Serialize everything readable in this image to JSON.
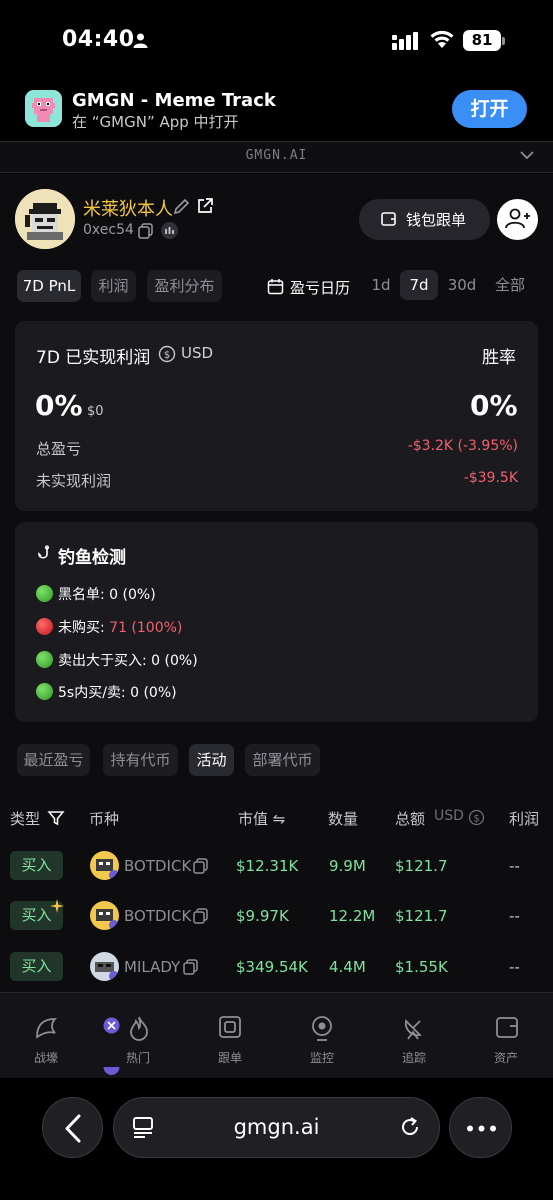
{
  "status_bar": {
    "time": "04:40",
    "battery": "81"
  },
  "banner": {
    "title": "GMGN - Meme Track",
    "subtitle": "在 “GMGN” App 中打开",
    "open_label": "打开"
  },
  "url_strip": {
    "text": "GMGN.AI"
  },
  "profile": {
    "nickname": "米莱狄本人",
    "address": "0xec54",
    "follow_label": "钱包跟单"
  },
  "period_tabs": {
    "items": [
      "7D PnL",
      "利润",
      "盈利分布"
    ],
    "calendar_label": "盈亏日历",
    "ranges": [
      "1d",
      "7d",
      "30d",
      "全部"
    ]
  },
  "pnl_card": {
    "title": "7D 已实现利润",
    "unit": "USD",
    "winrate_label": "胜率",
    "realized_pct": "0%",
    "realized_usd": "$0",
    "winrate_value": "0%",
    "total_label": "总盈亏",
    "total_value": "-$3.2K (-3.95%)",
    "unrealized_label": "未实现利润",
    "unrealized_value": "-$39.5K"
  },
  "phishing_card": {
    "title": "钓鱼检测",
    "checks": [
      {
        "label": "黑名单: ",
        "value": "0 (0%)",
        "status": "green"
      },
      {
        "label": "未购买: ",
        "value": "71 (100%)",
        "status": "red"
      },
      {
        "label": "卖出大于买入: ",
        "value": "0 (0%)",
        "status": "green"
      },
      {
        "label": "5s内买/卖: ",
        "value": "0 (0%)",
        "status": "green"
      }
    ]
  },
  "activity_tabs": {
    "items": [
      "最近盈亏",
      "持有代币",
      "活动",
      "部署代币"
    ]
  },
  "table": {
    "headers": {
      "type": "类型",
      "coin": "币种",
      "mcap": "市值 ⇋",
      "qty": "数量",
      "total": "总额",
      "usd": "USD",
      "profit": "利润"
    },
    "rows": [
      {
        "type": "买入",
        "coin": "BOTDICK",
        "mcap": "$12.31K",
        "qty": "9.9M",
        "total": "$121.7",
        "profit": "--"
      },
      {
        "type": "买入",
        "coin": "BOTDICK",
        "mcap": "$9.97K",
        "qty": "12.2M",
        "total": "$121.7",
        "profit": "--"
      },
      {
        "type": "买入",
        "coin": "MILADY",
        "mcap": "$349.54K",
        "qty": "4.4M",
        "total": "$1.55K",
        "profit": "--"
      }
    ]
  },
  "tabbar": {
    "items": [
      "战壕",
      "热门",
      "跟单",
      "监控",
      "追踪",
      "资产"
    ]
  },
  "safari": {
    "address": "gmgn.ai"
  },
  "colors": {
    "accent_green": "#7fe39d",
    "loss_red": "#f0616d",
    "nickname_gold": "#f4c542",
    "open_blue": "#3a8ff7"
  }
}
